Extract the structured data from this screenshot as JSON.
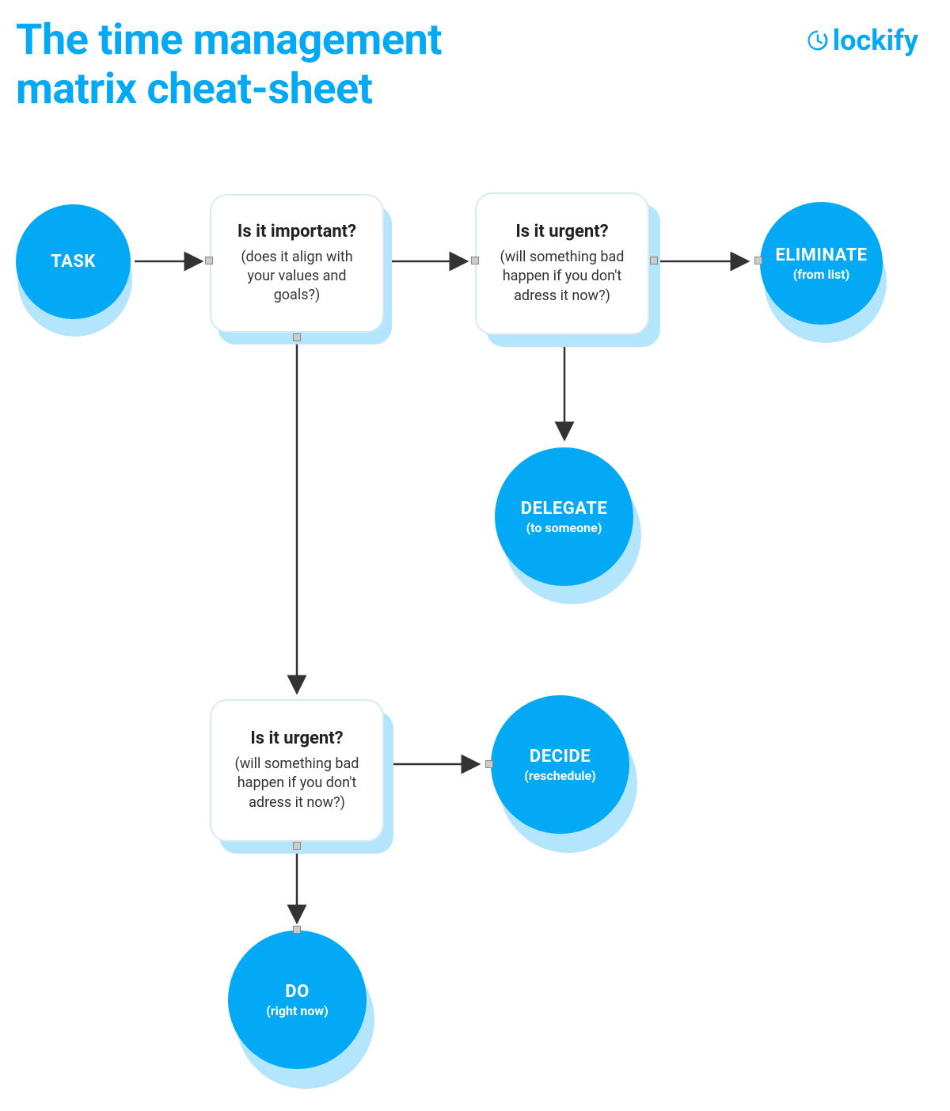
{
  "title": "The time management\nmatrix cheat-sheet",
  "logo": "lockify",
  "nodes": {
    "task": {
      "main": "TASK",
      "sub": ""
    },
    "important": {
      "q": "Is it important?",
      "d": "(does it align with your values and goals?)"
    },
    "urgent_top": {
      "q": "Is it urgent?",
      "d": "(will something bad happen if you don't adress it now?)"
    },
    "eliminate": {
      "main": "ELIMINATE",
      "sub": "(from list)"
    },
    "delegate": {
      "main": "DELEGATE",
      "sub": "(to someone)"
    },
    "urgent_bottom": {
      "q": "Is it urgent?",
      "d": "(will something bad happen if you don't adress it now?)"
    },
    "decide": {
      "main": "DECIDE",
      "sub": "(reschedule)"
    },
    "do": {
      "main": "DO",
      "sub": "(right now)"
    }
  }
}
